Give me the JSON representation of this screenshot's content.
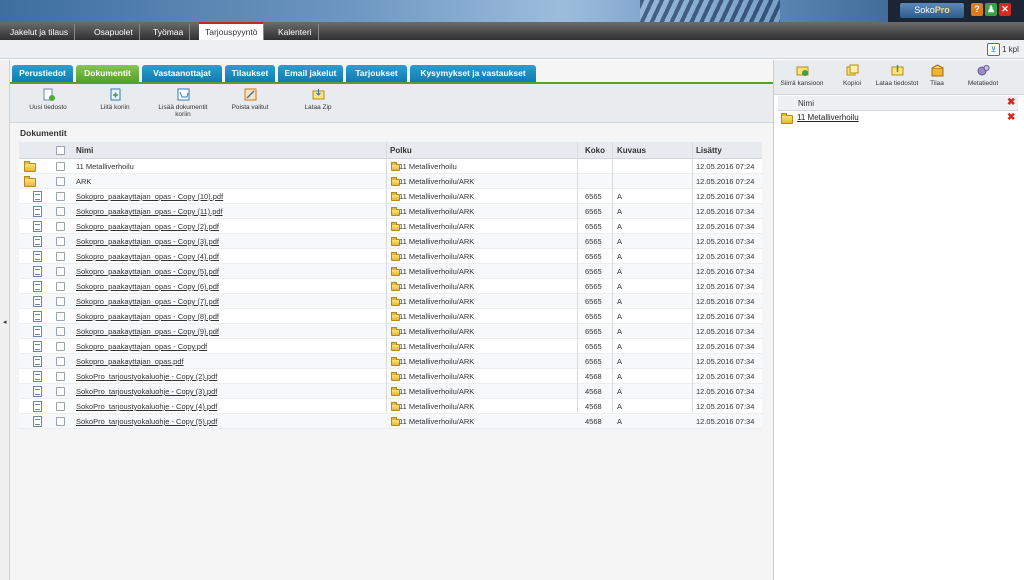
{
  "header": {
    "logo_text": "Soko",
    "logo_text_bold": "Pro",
    "help": "?",
    "user": "♟",
    "close": "✕"
  },
  "nav": {
    "tabs": [
      {
        "label": "Jakelut ja tilaus"
      },
      {
        "label": "Osapuolet"
      },
      {
        "label": "Työmaa"
      },
      {
        "label": "Tarjouspyyntö",
        "active": true
      },
      {
        "label": "Kalenteri"
      }
    ]
  },
  "cart": {
    "label": "1 kpl"
  },
  "page_tabs": [
    {
      "label": "Perustiedot"
    },
    {
      "label": "Dokumentit",
      "active": true
    },
    {
      "label": "Vastaanottajat"
    },
    {
      "label": "Tilaukset"
    },
    {
      "label": "Email jakelut"
    },
    {
      "label": "Tarjoukset"
    },
    {
      "label": "Kysymykset ja vastaukset"
    }
  ],
  "toolbar": [
    {
      "label": "Uusi tiedosto",
      "icon": "new-file-icon"
    },
    {
      "label": "Liitä koriin",
      "icon": "add-to-basket-icon"
    },
    {
      "label": "Lisää dokumentit koriin",
      "icon": "cart-icon"
    },
    {
      "label": "Poista valitut",
      "icon": "delete-selected-icon"
    },
    {
      "label": "Lataa Zip",
      "icon": "zip-download-icon"
    }
  ],
  "section_title": "Dokumentit",
  "table": {
    "columns": [
      "Nimi",
      "Polku",
      "Koko",
      "Kuvaus",
      "Lisätty"
    ],
    "rows": [
      {
        "type": "folder",
        "name": "11 Metalliverhoilu",
        "path": "11 Metalliverhoilu",
        "size": "",
        "desc": "",
        "added": "12.05.2016 07:24"
      },
      {
        "type": "folder",
        "name": "ARK",
        "path": "11 Metalliverhoilu/ARK",
        "size": "",
        "desc": "",
        "added": "12.05.2016 07:24"
      },
      {
        "type": "file",
        "name": "Sokopro_paakayttajan_opas - Copy (10).pdf",
        "path": "11 Metalliverhoilu/ARK",
        "size": "6565",
        "desc": "A",
        "added": "12.05.2016 07:34"
      },
      {
        "type": "file",
        "name": "Sokopro_paakayttajan_opas - Copy (11).pdf",
        "path": "11 Metalliverhoilu/ARK",
        "size": "6565",
        "desc": "A",
        "added": "12.05.2016 07:34"
      },
      {
        "type": "file",
        "name": "Sokopro_paakayttajan_opas - Copy (2).pdf",
        "path": "11 Metalliverhoilu/ARK",
        "size": "6565",
        "desc": "A",
        "added": "12.05.2016 07:34"
      },
      {
        "type": "file",
        "name": "Sokopro_paakayttajan_opas - Copy (3).pdf",
        "path": "11 Metalliverhoilu/ARK",
        "size": "6565",
        "desc": "A",
        "added": "12.05.2016 07:34"
      },
      {
        "type": "file",
        "name": "Sokopro_paakayttajan_opas - Copy (4).pdf",
        "path": "11 Metalliverhoilu/ARK",
        "size": "6565",
        "desc": "A",
        "added": "12.05.2016 07:34"
      },
      {
        "type": "file",
        "name": "Sokopro_paakayttajan_opas - Copy (5).pdf",
        "path": "11 Metalliverhoilu/ARK",
        "size": "6565",
        "desc": "A",
        "added": "12.05.2016 07:34"
      },
      {
        "type": "file",
        "name": "Sokopro_paakayttajan_opas - Copy (6).pdf",
        "path": "11 Metalliverhoilu/ARK",
        "size": "6565",
        "desc": "A",
        "added": "12.05.2016 07:34"
      },
      {
        "type": "file",
        "name": "Sokopro_paakayttajan_opas - Copy (7).pdf",
        "path": "11 Metalliverhoilu/ARK",
        "size": "6565",
        "desc": "A",
        "added": "12.05.2016 07:34"
      },
      {
        "type": "file",
        "name": "Sokopro_paakayttajan_opas - Copy (8).pdf",
        "path": "11 Metalliverhoilu/ARK",
        "size": "6565",
        "desc": "A",
        "added": "12.05.2016 07:34"
      },
      {
        "type": "file",
        "name": "Sokopro_paakayttajan_opas - Copy (9).pdf",
        "path": "11 Metalliverhoilu/ARK",
        "size": "6565",
        "desc": "A",
        "added": "12.05.2016 07:34"
      },
      {
        "type": "file",
        "name": "Sokopro_paakayttajan_opas - Copy.pdf",
        "path": "11 Metalliverhoilu/ARK",
        "size": "6565",
        "desc": "A",
        "added": "12.05.2016 07:34"
      },
      {
        "type": "file",
        "name": "Sokopro_paakayttajan_opas.pdf",
        "path": "11 Metalliverhoilu/ARK",
        "size": "6565",
        "desc": "A",
        "added": "12.05.2016 07:34"
      },
      {
        "type": "file",
        "name": "SokoPro_tarjoustyokaluohje - Copy (2).pdf",
        "path": "11 Metalliverhoilu/ARK",
        "size": "4568",
        "desc": "A",
        "added": "12.05.2016 07:34"
      },
      {
        "type": "file",
        "name": "SokoPro_tarjoustyokaluohje - Copy (3).pdf",
        "path": "11 Metalliverhoilu/ARK",
        "size": "4568",
        "desc": "A",
        "added": "12.05.2016 07:34"
      },
      {
        "type": "file",
        "name": "SokoPro_tarjoustyokaluohje - Copy (4).pdf",
        "path": "11 Metalliverhoilu/ARK",
        "size": "4568",
        "desc": "A",
        "added": "12.05.2016 07:34"
      },
      {
        "type": "file",
        "name": "SokoPro_tarjoustyokaluohje - Copy (5).pdf",
        "path": "11 Metalliverhoilu/ARK",
        "size": "4568",
        "desc": "A",
        "added": "12.05.2016 07:34"
      }
    ]
  },
  "right_panel": {
    "toolbar": [
      {
        "label": "Siirrä kansioon",
        "icon": "move-to-folder-icon"
      },
      {
        "label": "Kopioi",
        "icon": "copy-icon"
      },
      {
        "label": "Lataa tiedostot",
        "icon": "download-files-icon"
      },
      {
        "label": "Tilaa",
        "icon": "order-icon"
      },
      {
        "label": "Metatiedot",
        "icon": "metadata-icon"
      }
    ],
    "column": "Nimi",
    "items": [
      {
        "name": "11 Metalliverhoilu"
      }
    ]
  },
  "colors": {
    "tab_blue": "#137ab0",
    "tab_active_green": "#56a12a",
    "nav_active_border": "#c0262d",
    "delete_red": "#d62a1e"
  }
}
